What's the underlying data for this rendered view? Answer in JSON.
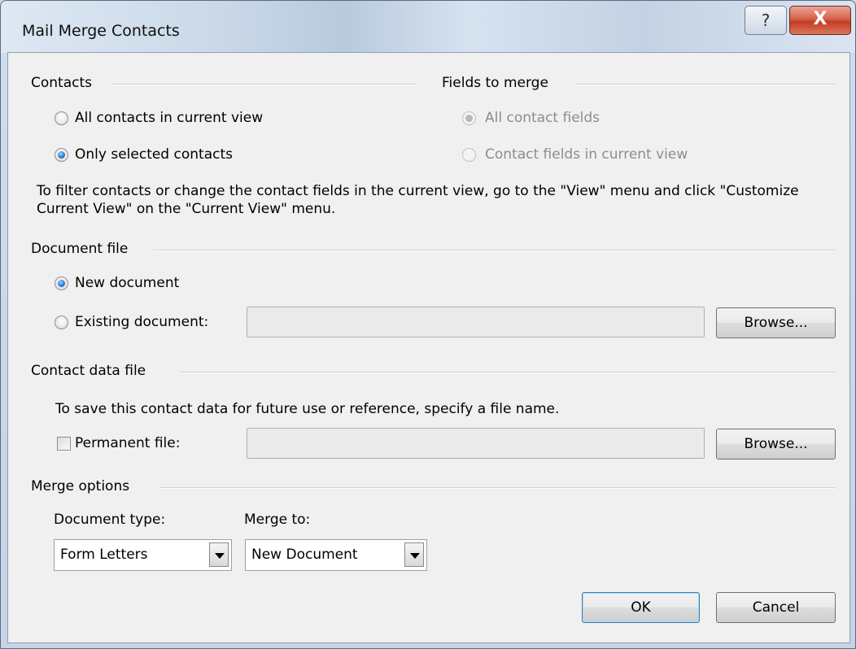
{
  "window": {
    "title": "Mail Merge Contacts",
    "help_glyph": "?",
    "close_glyph": "X"
  },
  "contacts": {
    "heading": "Contacts",
    "options": [
      {
        "label": "All contacts in current view",
        "selected": false
      },
      {
        "label": "Only selected contacts",
        "selected": true
      }
    ]
  },
  "fields": {
    "heading": "Fields to merge",
    "options": [
      {
        "label": "All contact fields",
        "selected": true,
        "enabled": false
      },
      {
        "label": "Contact fields in current view",
        "selected": false,
        "enabled": false
      }
    ]
  },
  "filter_note": "To filter contacts or change the contact fields in the current view, go to the \"View\" menu and click \"Customize Current View\" on the \"Current View\" menu.",
  "document_file": {
    "heading": "Document file",
    "new_label": "New document",
    "existing_label": "Existing document:",
    "existing_value": "",
    "browse_label": "Browse..."
  },
  "contact_data_file": {
    "heading": "Contact data file",
    "note": "To save this contact data for future use or reference, specify a file name.",
    "permanent_label": "Permanent file:",
    "permanent_checked": false,
    "permanent_value": "",
    "browse_label": "Browse..."
  },
  "merge_options": {
    "heading": "Merge options",
    "doc_type_label": "Document type:",
    "doc_type_value": "Form Letters",
    "merge_to_label": "Merge to:",
    "merge_to_value": "New Document"
  },
  "buttons": {
    "ok": "OK",
    "cancel": "Cancel"
  }
}
